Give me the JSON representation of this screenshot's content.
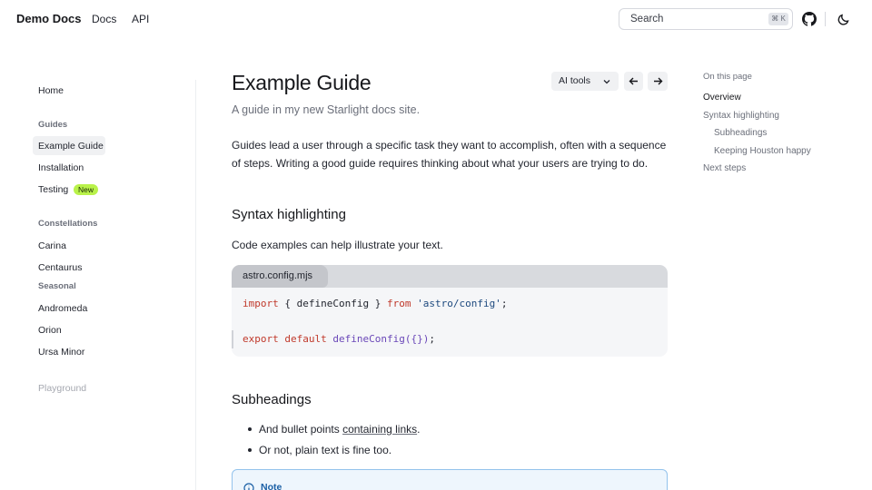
{
  "header": {
    "site_title": "Demo Docs",
    "nav": [
      {
        "label": "Docs"
      },
      {
        "label": "API"
      }
    ],
    "search": {
      "label": "Search",
      "shortcut": "⌘ K"
    },
    "icons": [
      "github-icon",
      "moon-icon"
    ]
  },
  "sidebar": {
    "home": "Home",
    "groups": [
      {
        "title": "Guides",
        "items": [
          "Example Guide",
          "Installation",
          "Testing"
        ]
      },
      {
        "title": "Constellations",
        "items": [
          "Carina",
          "Centaurus"
        ]
      },
      {
        "title": "Seasonal",
        "items": [
          "Andromeda",
          "Orion",
          "Ursa Minor"
        ]
      }
    ],
    "badge": "New",
    "playground": "Playground"
  },
  "main": {
    "title": "Example Guide",
    "ai_tools": "AI tools",
    "lead": "A guide in my new Starlight docs site.",
    "intro": "Guides lead a user through a specific task they want to accomplish, often with a sequence of steps. Writing a good guide requires thinking about what your users are trying to do.",
    "h2_syntax": "Syntax highlighting",
    "code_intro": "Code examples can help illustrate your text.",
    "code": {
      "filename": "astro.config.mjs",
      "l1_kw1": "import",
      "l1_mid": " { defineConfig } ",
      "l1_kw2": "from",
      "l1_str": "'astro/config'",
      "l1_end": ";",
      "l2_kw1": "export",
      "l2_kw2": "default",
      "l2_fn": "defineConfig",
      "l2_p1": "(",
      "l2_obj": "{}",
      "l2_p2": ")",
      "l2_end": ";"
    },
    "h2_sub": "Subheadings",
    "list": {
      "item1_pre": "And bullet points ",
      "item1_link": "containing links",
      "item1_post": ".",
      "item2": "Or not, plain text is fine too."
    },
    "note": "Note"
  },
  "toc": {
    "title": "On this page",
    "items": [
      "Overview",
      "Syntax highlighting",
      "Subheadings",
      "Keeping Houston happy",
      "Next steps"
    ]
  },
  "colors": {
    "badge_bg": "#b9f24a",
    "note_border": "#93c3ec",
    "note_bg": "#eef6fd",
    "keyword": "#c0392b",
    "string": "#1e4a7f",
    "function": "#6a47b8"
  }
}
